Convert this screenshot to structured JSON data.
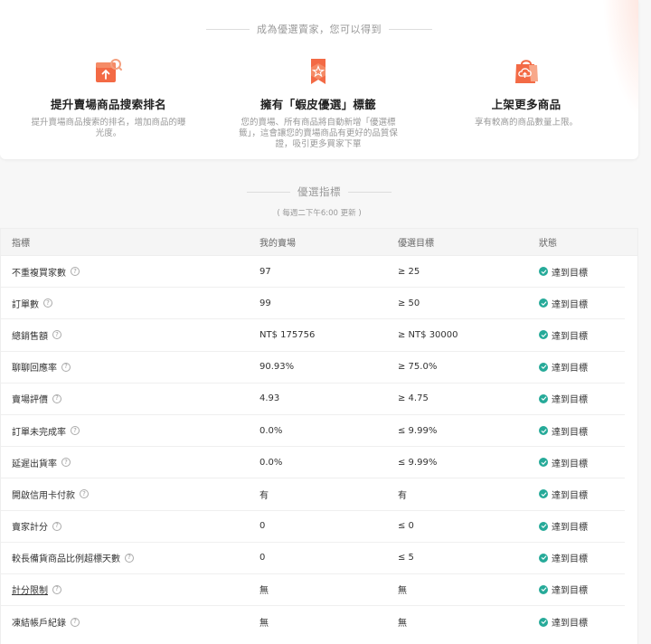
{
  "benefits_section": {
    "title": "成為優選賣家，您可以得到",
    "items": [
      {
        "title": "提升賣場商品搜索排名",
        "desc": "提升賣場商品搜索的排名，增加商品的曝光度。",
        "icon": "search-rank-icon"
      },
      {
        "title": "擁有「蝦皮優選」標籤",
        "desc": "您的賣場、所有商品將自動新增「優選標籤」，這會讓您的賣場商品有更好的品質保證，吸引更多買家下單",
        "icon": "preferred-badge-icon"
      },
      {
        "title": "上架更多商品",
        "desc": "享有較高的商品數量上限。",
        "icon": "upload-bag-icon"
      }
    ],
    "accent_color": "#ee4d2d"
  },
  "metrics": {
    "title": "優選指標",
    "subtitle": "( 每週二下午6:00 更新 )",
    "columns": [
      "指標",
      "我的賣場",
      "優選目標",
      "狀態"
    ],
    "rows": [
      {
        "name": "不重複買家數",
        "mine": "97",
        "target": "≥ 25",
        "status": "達到目標"
      },
      {
        "name": "訂單數",
        "mine": "99",
        "target": "≥ 50",
        "status": "達到目標"
      },
      {
        "name": "總銷售額",
        "mine": "NT$ 175756",
        "target": "≥ NT$ 30000",
        "status": "達到目標"
      },
      {
        "name": "聊聊回應率",
        "mine": "90.93%",
        "target": "≥ 75.0%",
        "status": "達到目標"
      },
      {
        "name": "賣場評價",
        "mine": "4.93",
        "target": "≥ 4.75",
        "status": "達到目標"
      },
      {
        "name": "訂單未完成率",
        "mine": "0.0%",
        "target": "≤ 9.99%",
        "status": "達到目標"
      },
      {
        "name": "延遲出貨率",
        "mine": "0.0%",
        "target": "≤ 9.99%",
        "status": "達到目標"
      },
      {
        "name": "開啟信用卡付款",
        "mine": "有",
        "target": "有",
        "status": "達到目標"
      },
      {
        "name": "賣家計分",
        "mine": "0",
        "target": "≤ 0",
        "status": "達到目標"
      },
      {
        "name": "較長備貨商品比例超標天數",
        "mine": "0",
        "target": "≤ 5",
        "status": "達到目標"
      },
      {
        "name": "計分限制",
        "mine": "無",
        "target": "無",
        "status": "達到目標",
        "link": true
      },
      {
        "name": "凍結帳戶紀錄",
        "mine": "無",
        "target": "無",
        "status": "達到目標"
      }
    ],
    "status_color": "#26aa99",
    "help_icon": "question-circle-icon",
    "status_icon": "check-circle-icon"
  }
}
